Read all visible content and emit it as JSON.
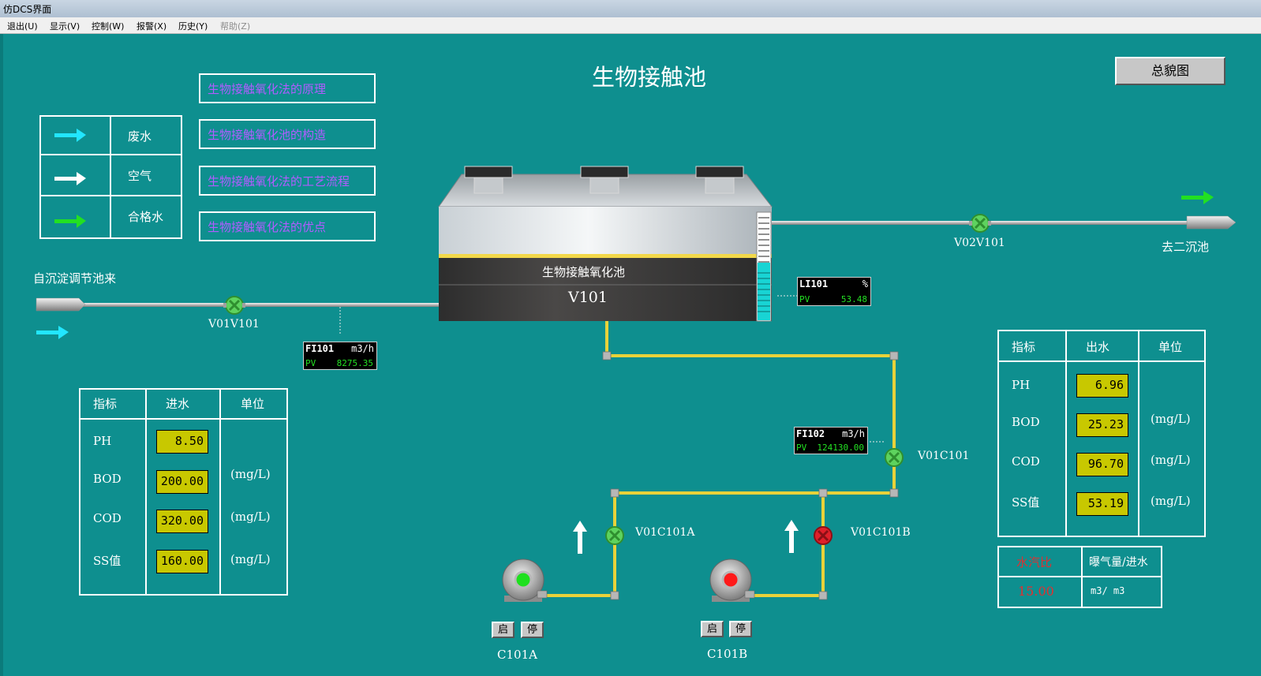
{
  "window": {
    "title": "仿DCS界面"
  },
  "menu": [
    {
      "label": "退出(U)",
      "enabled": true
    },
    {
      "label": "显示(V)",
      "enabled": true
    },
    {
      "label": "控制(W)",
      "enabled": true
    },
    {
      "label": "报警(X)",
      "enabled": true
    },
    {
      "label": "历史(Y)",
      "enabled": true
    },
    {
      "label": "帮助(Z)",
      "enabled": false
    }
  ],
  "page": {
    "title": "生物接触池",
    "overview_button": "总貌图"
  },
  "topics": [
    "生物接触氧化法的原理",
    "生物接触氧化池的构造",
    "生物接触氧化法的工艺流程",
    "生物接触氧化法的优点"
  ],
  "legend": [
    {
      "label": "废水",
      "color": "#22e6ff"
    },
    {
      "label": "空气",
      "color": "#ffffff"
    },
    {
      "label": "合格水",
      "color": "#22e022"
    }
  ],
  "tank": {
    "name": "生物接触氧化池",
    "tag": "V101"
  },
  "flow": {
    "inlet_label": "自沉淀调节池来",
    "outlet_label": "去二沉池"
  },
  "valves": {
    "v01v101": {
      "label": "V01V101",
      "state": "open"
    },
    "v02v101": {
      "label": "V02V101",
      "state": "open"
    },
    "v01c101": {
      "label": "V01C101",
      "state": "open"
    },
    "v01c101a": {
      "label": "V01C101A",
      "state": "open"
    },
    "v01c101b": {
      "label": "V01C101B",
      "state": "closed"
    }
  },
  "instruments": {
    "li101": {
      "name": "LI101",
      "unit": "%",
      "pv_label": "PV",
      "value": "53.48"
    },
    "fi101": {
      "name": "FI101",
      "unit": "m3/h",
      "pv_label": "PV",
      "value": "8275.35"
    },
    "fi102": {
      "name": "FI102",
      "unit": "m3/h",
      "pv_label": "PV",
      "value": "124130.00"
    }
  },
  "inlet_table": {
    "headers": [
      "指标",
      "进水",
      "单位"
    ],
    "rows": [
      {
        "name": "PH",
        "value": "8.50",
        "unit": ""
      },
      {
        "name": "BOD",
        "value": "200.00",
        "unit": "(mg/L)"
      },
      {
        "name": "COD",
        "value": "320.00",
        "unit": "(mg/L)"
      },
      {
        "name": "SS值",
        "value": "160.00",
        "unit": "(mg/L)"
      }
    ]
  },
  "outlet_table": {
    "headers": [
      "指标",
      "出水",
      "单位"
    ],
    "rows": [
      {
        "name": "PH",
        "value": "6.96",
        "unit": ""
      },
      {
        "name": "BOD",
        "value": "25.23",
        "unit": "(mg/L)"
      },
      {
        "name": "COD",
        "value": "96.70",
        "unit": "(mg/L)"
      },
      {
        "name": "SS值",
        "value": "53.19",
        "unit": "(mg/L)"
      }
    ]
  },
  "ratio_table": {
    "label": "水汽比",
    "desc": "曝气量/进水",
    "value": "15.00",
    "unit": "m3/ m3"
  },
  "pumps": {
    "a": {
      "name": "C101A",
      "state": "running",
      "start": "启",
      "stop": "停"
    },
    "b": {
      "name": "C101B",
      "state": "stopped",
      "start": "启",
      "stop": "停"
    }
  },
  "colors": {
    "background": "#0e8f8f",
    "pipe_water": "#c9c9c9",
    "pipe_air": "#e8d23a",
    "value_box": "#c8c800",
    "valve_open": "#5ed35e",
    "valve_closed": "#e0202a",
    "ratio_red": "#e03030"
  }
}
